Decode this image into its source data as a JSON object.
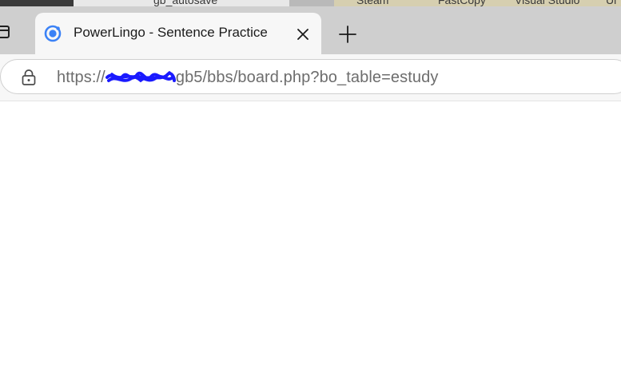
{
  "browser": {
    "tab": {
      "title": "PowerLingo - Sentence Practice",
      "favicon": "ionic-logo-icon"
    },
    "address": {
      "url_prefix": "https://",
      "url_suffix": "gb5/bbs/board.php?bo_table=estudy"
    },
    "colors": {
      "tabbar": "#cfcfcf",
      "active_tab": "#f7f7f7",
      "favicon": "#3b82f6",
      "redaction": "#1a1aff"
    }
  },
  "desktop_background": {
    "items": [
      "gb_autosave",
      "Steam",
      "FastCopy",
      "Visual Studio",
      "Ui"
    ]
  }
}
